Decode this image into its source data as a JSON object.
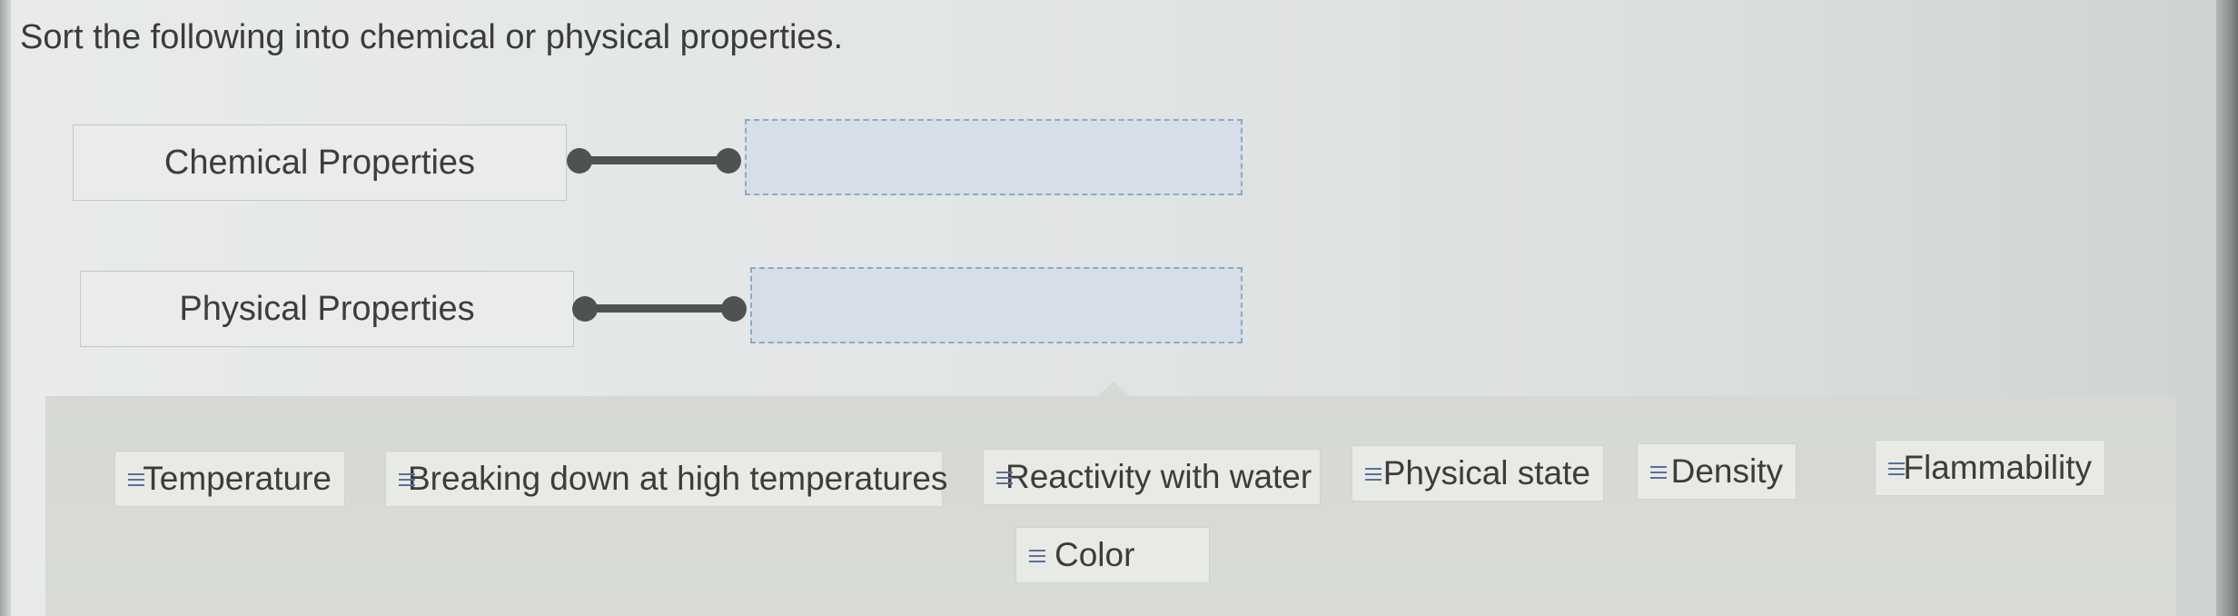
{
  "question": {
    "text": "Sort the following into chemical or physical properties."
  },
  "categories": [
    {
      "label": "Chemical Properties"
    },
    {
      "label": "Physical Properties"
    }
  ],
  "chips": [
    {
      "label": "Temperature",
      "icon": "drag-handle-icon"
    },
    {
      "label": "Breaking down at high temperatures",
      "icon": "drag-handle-icon"
    },
    {
      "label": "Reactivity with water",
      "icon": "drag-handle-icon"
    },
    {
      "label": "Physical state",
      "icon": "drag-handle-icon"
    },
    {
      "label": "Density",
      "icon": "drag-handle-icon"
    },
    {
      "label": "Flammability",
      "icon": "drag-handle-icon"
    },
    {
      "label": "Color",
      "icon": "drag-handle-icon"
    }
  ],
  "colors": {
    "dropzone_fill": "#d6dfe8",
    "dropzone_border": "#8ea9c6",
    "connector": "#4f5253",
    "grip_icon": "#5b6f9a"
  }
}
